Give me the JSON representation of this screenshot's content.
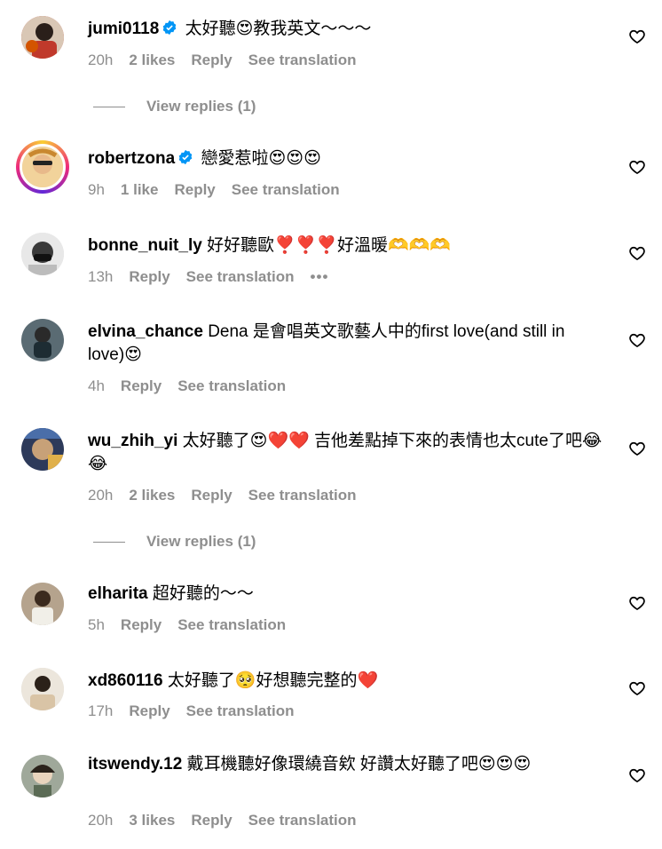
{
  "comments": [
    {
      "username": "jumi0118",
      "verified": true,
      "text": "太好聽😍教我英文～～～",
      "time": "20h",
      "likes": "2 likes",
      "reply": "Reply",
      "translate": "See translation",
      "view_replies": "View replies (1)"
    },
    {
      "username": "robertzona",
      "verified": true,
      "text": "戀愛惹啦😍😍😍",
      "time": "9h",
      "likes": "1 like",
      "reply": "Reply",
      "translate": "See translation"
    },
    {
      "username": "bonne_nuit_ly",
      "verified": false,
      "text": "好好聽歐❣️❣️❣️好溫暖🫶🫶🫶",
      "time": "13h",
      "reply": "Reply",
      "translate": "See translation",
      "more": "•••"
    },
    {
      "username": "elvina_chance",
      "verified": false,
      "text": "Dena 是會唱英文歌藝人中的first love(and still in love)😍",
      "time": "4h",
      "reply": "Reply",
      "translate": "See translation"
    },
    {
      "username": "wu_zhih_yi",
      "verified": false,
      "text": "太好聽了😍❤️❤️ 吉他差點掉下來的表情也太cute了吧😂😂",
      "time": "20h",
      "likes": "2 likes",
      "reply": "Reply",
      "translate": "See translation",
      "view_replies": "View replies (1)"
    },
    {
      "username": "elharita",
      "verified": false,
      "text": "超好聽的～～",
      "time": "5h",
      "reply": "Reply",
      "translate": "See translation"
    },
    {
      "username": "xd860116",
      "verified": false,
      "text": "太好聽了🥺好想聽完整的❤️",
      "time": "17h",
      "reply": "Reply",
      "translate": "See translation"
    },
    {
      "username": "itswendy.12",
      "verified": false,
      "text": "戴耳機聽好像環繞音欸 好讚太好聽了吧😍😍😍",
      "time": "20h",
      "likes": "3 likes",
      "reply": "Reply",
      "translate": "See translation"
    }
  ],
  "icons": {
    "verified": "verified-badge-icon",
    "like": "heart-outline-icon"
  },
  "colors": {
    "meta_gray": "#8e8e8e",
    "verified_blue": "#0095f6",
    "heart_emoji_red": "#e0245e"
  }
}
